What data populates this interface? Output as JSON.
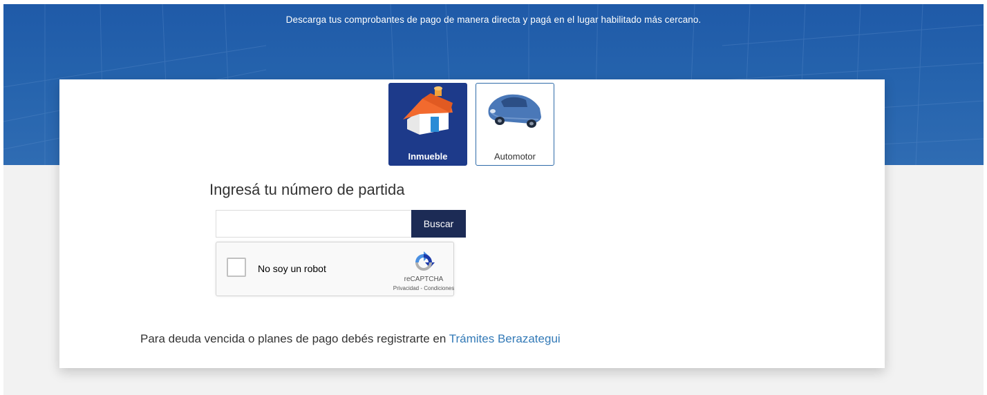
{
  "banner": {
    "text": "Descarga tus comprobantes de pago de manera directa y pagá en el lugar habilitado más cercano."
  },
  "tabs": [
    {
      "label": "Inmueble",
      "icon": "house-icon",
      "selected": true
    },
    {
      "label": "Automotor",
      "icon": "car-icon",
      "selected": false
    }
  ],
  "form": {
    "heading": "Ingresá tu número de partida",
    "input_value": "",
    "input_placeholder": "",
    "search_label": "Buscar"
  },
  "captcha": {
    "label": "No soy un robot",
    "brand": "reCAPTCHA",
    "privacy": "Privacidad",
    "separator": " - ",
    "terms": "Condiciones",
    "icon": "recaptcha-logo-icon",
    "checked": false
  },
  "footer": {
    "text": "Para deuda vencida o planes de pago debés registrarte en ",
    "link": "Trámites Berazategui"
  },
  "colors": {
    "banner": "#2563ad",
    "selected_tab": "#1d3a8a",
    "search_button": "#1c2b55",
    "link": "#337ab7"
  }
}
